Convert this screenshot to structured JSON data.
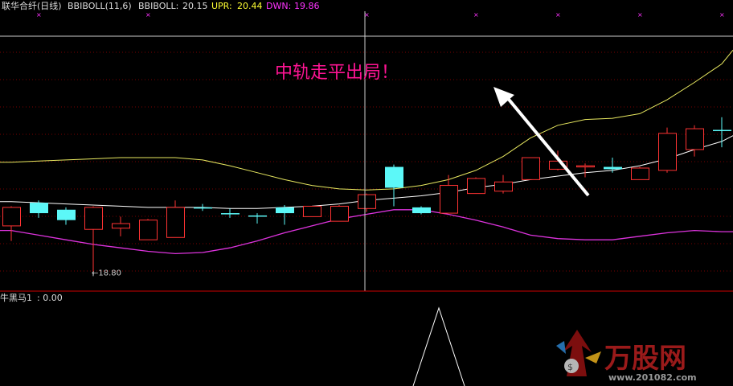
{
  "header": {
    "title": "联华合纤(日线)",
    "indicator": "BBIBOLL(11,6)",
    "bbiboll_label": "BBIBOLL:",
    "bbiboll_value": "20.15",
    "upr_label": "UPR:",
    "upr_value": "20.44",
    "dwn_label": "DWN:",
    "dwn_value": "19.86"
  },
  "annotation": {
    "text": "中轨走平出局！",
    "min_label": "←18.80"
  },
  "sub_panel": {
    "label": "牛黑马1",
    "value": ": 0.00"
  },
  "watermark": {
    "brand": "万股网",
    "url": "www.201082.com"
  },
  "colors": {
    "background": "#000000",
    "up": "#ff3333",
    "down": "#5cf8f8",
    "mid_line": "#ffffff",
    "upper_band": "#e8e860",
    "lower_band": "#dd33dd",
    "grid": "#7a0000",
    "title_text": "#dddddd",
    "upr_text": "#ffff33",
    "dwn_text": "#ff33ff",
    "annotation_text": "#ff1493"
  },
  "chart_data": {
    "type": "candlestick",
    "title": "联华合纤(日线)",
    "ylim": [
      18.65,
      21.0
    ],
    "candles": [
      {
        "o": 19.2,
        "h": 19.37,
        "l": 19.07,
        "c": 19.36
      },
      {
        "o": 19.4,
        "h": 19.42,
        "l": 19.27,
        "c": 19.31
      },
      {
        "o": 19.34,
        "h": 19.36,
        "l": 19.21,
        "c": 19.25
      },
      {
        "o": 19.17,
        "h": 19.37,
        "l": 18.8,
        "c": 19.36
      },
      {
        "o": 19.18,
        "h": 19.28,
        "l": 19.11,
        "c": 19.22
      },
      {
        "o": 19.08,
        "h": 19.26,
        "l": 19.08,
        "c": 19.25
      },
      {
        "o": 19.1,
        "h": 19.42,
        "l": 19.1,
        "c": 19.36
      },
      {
        "o": 19.36,
        "h": 19.39,
        "l": 19.33,
        "c": 19.35
      },
      {
        "o": 19.31,
        "h": 19.35,
        "l": 19.27,
        "c": 19.3
      },
      {
        "o": 19.29,
        "h": 19.31,
        "l": 19.22,
        "c": 19.28
      },
      {
        "o": 19.36,
        "h": 19.38,
        "l": 19.21,
        "c": 19.31
      },
      {
        "o": 19.28,
        "h": 19.37,
        "l": 19.28,
        "c": 19.37
      },
      {
        "o": 19.24,
        "h": 19.38,
        "l": 19.24,
        "c": 19.37
      },
      {
        "o": 19.35,
        "h": 19.48,
        "l": 19.32,
        "c": 19.47
      },
      {
        "o": 19.71,
        "h": 19.73,
        "l": 19.37,
        "c": 19.53
      },
      {
        "o": 19.36,
        "h": 19.37,
        "l": 19.3,
        "c": 19.31
      },
      {
        "o": 19.31,
        "h": 19.64,
        "l": 19.31,
        "c": 19.55
      },
      {
        "o": 19.48,
        "h": 19.62,
        "l": 19.48,
        "c": 19.61
      },
      {
        "o": 19.5,
        "h": 19.64,
        "l": 19.48,
        "c": 19.58
      },
      {
        "o": 19.6,
        "h": 19.79,
        "l": 19.6,
        "c": 19.79
      },
      {
        "o": 19.69,
        "h": 19.85,
        "l": 19.68,
        "c": 19.76
      },
      {
        "o": 19.72,
        "h": 19.74,
        "l": 19.62,
        "c": 19.72
      },
      {
        "o": 19.71,
        "h": 19.79,
        "l": 19.66,
        "c": 19.69
      },
      {
        "o": 19.6,
        "h": 19.71,
        "l": 19.6,
        "c": 19.7
      },
      {
        "o": 19.68,
        "h": 20.05,
        "l": 19.66,
        "c": 20.0
      },
      {
        "o": 19.86,
        "h": 20.07,
        "l": 19.8,
        "c": 20.04
      },
      {
        "o": 20.03,
        "h": 20.14,
        "l": 19.88,
        "c": 20.02
      }
    ],
    "mid": [
      19.41,
      19.4,
      19.39,
      19.38,
      19.37,
      19.36,
      19.36,
      19.36,
      19.35,
      19.35,
      19.36,
      19.37,
      19.39,
      19.42,
      19.44,
      19.46,
      19.49,
      19.53,
      19.56,
      19.6,
      19.63,
      19.66,
      19.68,
      19.72,
      19.78,
      19.86,
      19.93
    ],
    "upper": [
      19.75,
      19.76,
      19.77,
      19.78,
      19.79,
      19.79,
      19.79,
      19.77,
      19.72,
      19.66,
      19.6,
      19.55,
      19.52,
      19.51,
      19.52,
      19.55,
      19.6,
      19.68,
      19.8,
      19.96,
      20.07,
      20.12,
      20.13,
      20.17,
      20.29,
      20.44,
      20.6
    ],
    "lower": [
      19.16,
      19.12,
      19.08,
      19.04,
      19.01,
      18.98,
      18.96,
      18.97,
      19.01,
      19.07,
      19.14,
      19.2,
      19.26,
      19.3,
      19.34,
      19.34,
      19.3,
      19.25,
      19.19,
      19.12,
      19.09,
      19.08,
      19.08,
      19.11,
      19.14,
      19.16,
      19.15
    ],
    "markers": [
      1,
      5,
      13,
      17,
      20,
      23,
      26
    ],
    "crosshair_index": 13,
    "sub_peak_index": 16
  }
}
